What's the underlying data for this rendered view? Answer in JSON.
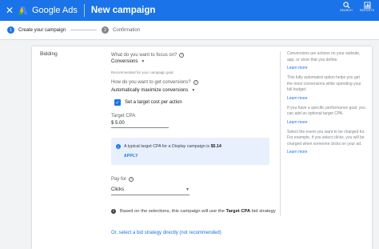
{
  "header": {
    "close_icon": "✕",
    "brand": "Google Ads",
    "title": "New campaign",
    "actions": [
      {
        "icon": "search-icon",
        "glyph": "🔍",
        "label": "SEARCH"
      },
      {
        "icon": "reports-icon",
        "glyph": "📊",
        "label": "REPORTS"
      }
    ],
    "colors": {
      "bar": "#1a73e8"
    }
  },
  "stepper": {
    "steps": [
      {
        "num": "1",
        "label": "Create your campaign"
      },
      {
        "num": "2",
        "label": "Confirmation"
      }
    ]
  },
  "section": {
    "label": "Bidding",
    "focus_question": "What do you want to focus on?",
    "focus_value": "Conversions",
    "focus_hint": "Recommended for your campaign goal",
    "how_question": "How do you want to get conversions?",
    "how_value": "Automatically maximize conversions",
    "checkbox_label": "Set a target cost per action",
    "target_cpa_label": "Target CPA",
    "target_cpa_value": "$ 5.00",
    "info_text_prefix": "A typical target CPA for a Display campaign is",
    "info_text_value": "$5.14",
    "apply_label": "APPLY",
    "pay_for_label": "Pay for",
    "pay_for_value": "Clicks",
    "note_prefix": "Based on the selections, this campaign will use the",
    "note_bold": "Target CPA",
    "note_suffix": "bid strategy",
    "alt_link": "Or, select a bid strategy directly (not recommended)"
  },
  "side_panel": {
    "blocks": [
      {
        "text": "Conversions are actions on your website, app, or store that you define.",
        "link": "Learn more"
      },
      {
        "text": "This fully automated option helps you get the most conversions while spending your full budget.",
        "link": "Learn more"
      },
      {
        "text": "If you have a specific performance goal, you can add an optional target CPA.",
        "link": "Learn more"
      },
      {
        "text": "Select the event you want to be charged for. For example, if you select clicks, you will be charged when someone clicks on your ad.",
        "link": "Learn more"
      }
    ]
  }
}
